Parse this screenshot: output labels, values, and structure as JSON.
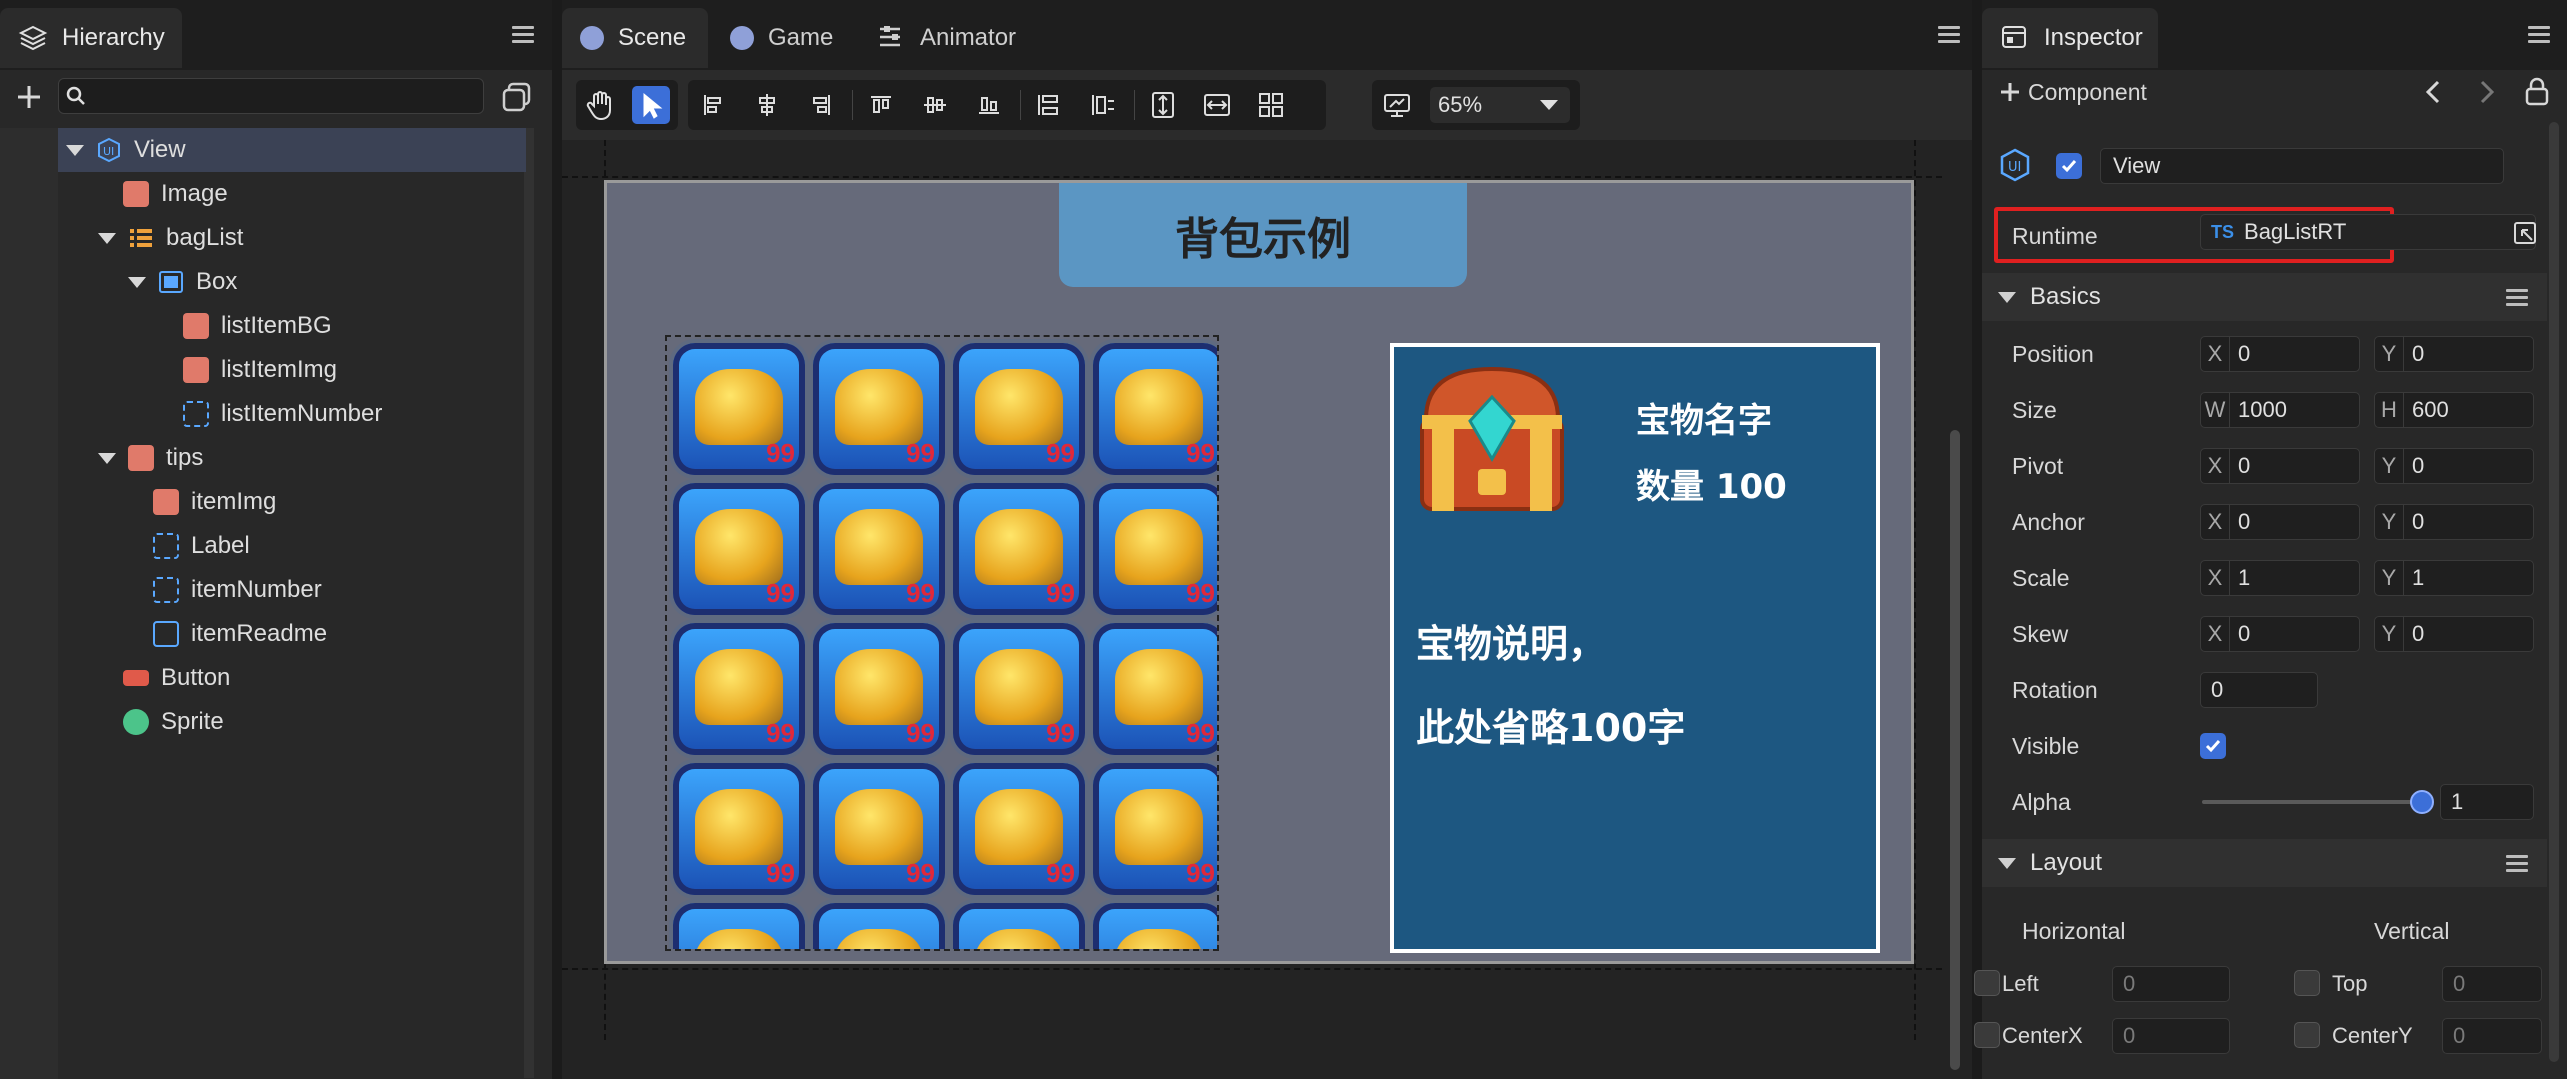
{
  "hierarchy": {
    "tab": "Hierarchy",
    "search_placeholder": "",
    "nodes": [
      {
        "label": "View"
      },
      {
        "label": "Image"
      },
      {
        "label": "bagList"
      },
      {
        "label": "Box"
      },
      {
        "label": "listItemBG"
      },
      {
        "label": "listItemImg"
      },
      {
        "label": "listItemNumber"
      },
      {
        "label": "tips"
      },
      {
        "label": "itemImg"
      },
      {
        "label": "Label"
      },
      {
        "label": "itemNumber"
      },
      {
        "label": "itemReadme"
      },
      {
        "label": "Button"
      },
      {
        "label": "Sprite"
      }
    ]
  },
  "scene": {
    "tabs": [
      {
        "label": "Scene"
      },
      {
        "label": "Game"
      },
      {
        "label": "Animator"
      }
    ],
    "zoom": "65%",
    "stage": {
      "title": "背包示例",
      "item_number": "99",
      "item_name": "宝物名字",
      "item_count": "数量 100",
      "desc_line1": "宝物说明，",
      "desc_line2": "此处省略100字"
    }
  },
  "inspector": {
    "tab": "Inspector",
    "component_label": "Component",
    "node_name": "View",
    "runtime_label": "Runtime",
    "runtime_badge": "TS",
    "runtime_value": "BagListRT",
    "basics_title": "Basics",
    "position": {
      "label": "Position",
      "x": "0",
      "y": "0"
    },
    "size": {
      "label": "Size",
      "w": "1000",
      "h": "600"
    },
    "pivot": {
      "label": "Pivot",
      "x": "0",
      "y": "0"
    },
    "anchor": {
      "label": "Anchor",
      "x": "0",
      "y": "0"
    },
    "scale": {
      "label": "Scale",
      "x": "1",
      "y": "1"
    },
    "skew": {
      "label": "Skew",
      "x": "0",
      "y": "0"
    },
    "rotation": {
      "label": "Rotation",
      "value": "0"
    },
    "visible_label": "Visible",
    "alpha": {
      "label": "Alpha",
      "value": "1",
      "level": 1
    },
    "layout_title": "Layout",
    "horizontal": "Horizontal",
    "vertical": "Vertical",
    "left": {
      "label": "Left",
      "value": "0"
    },
    "top": {
      "label": "Top",
      "value": "0"
    },
    "centerx": {
      "label": "CenterX",
      "value": "0"
    },
    "centery": {
      "label": "CenterY",
      "value": "0"
    },
    "axis": {
      "x": "X",
      "y": "Y",
      "w": "W",
      "h": "H"
    }
  },
  "colors": {
    "accent": "#3c6fd8",
    "selection": "#3b4255",
    "highlight_border": "#e02020"
  }
}
